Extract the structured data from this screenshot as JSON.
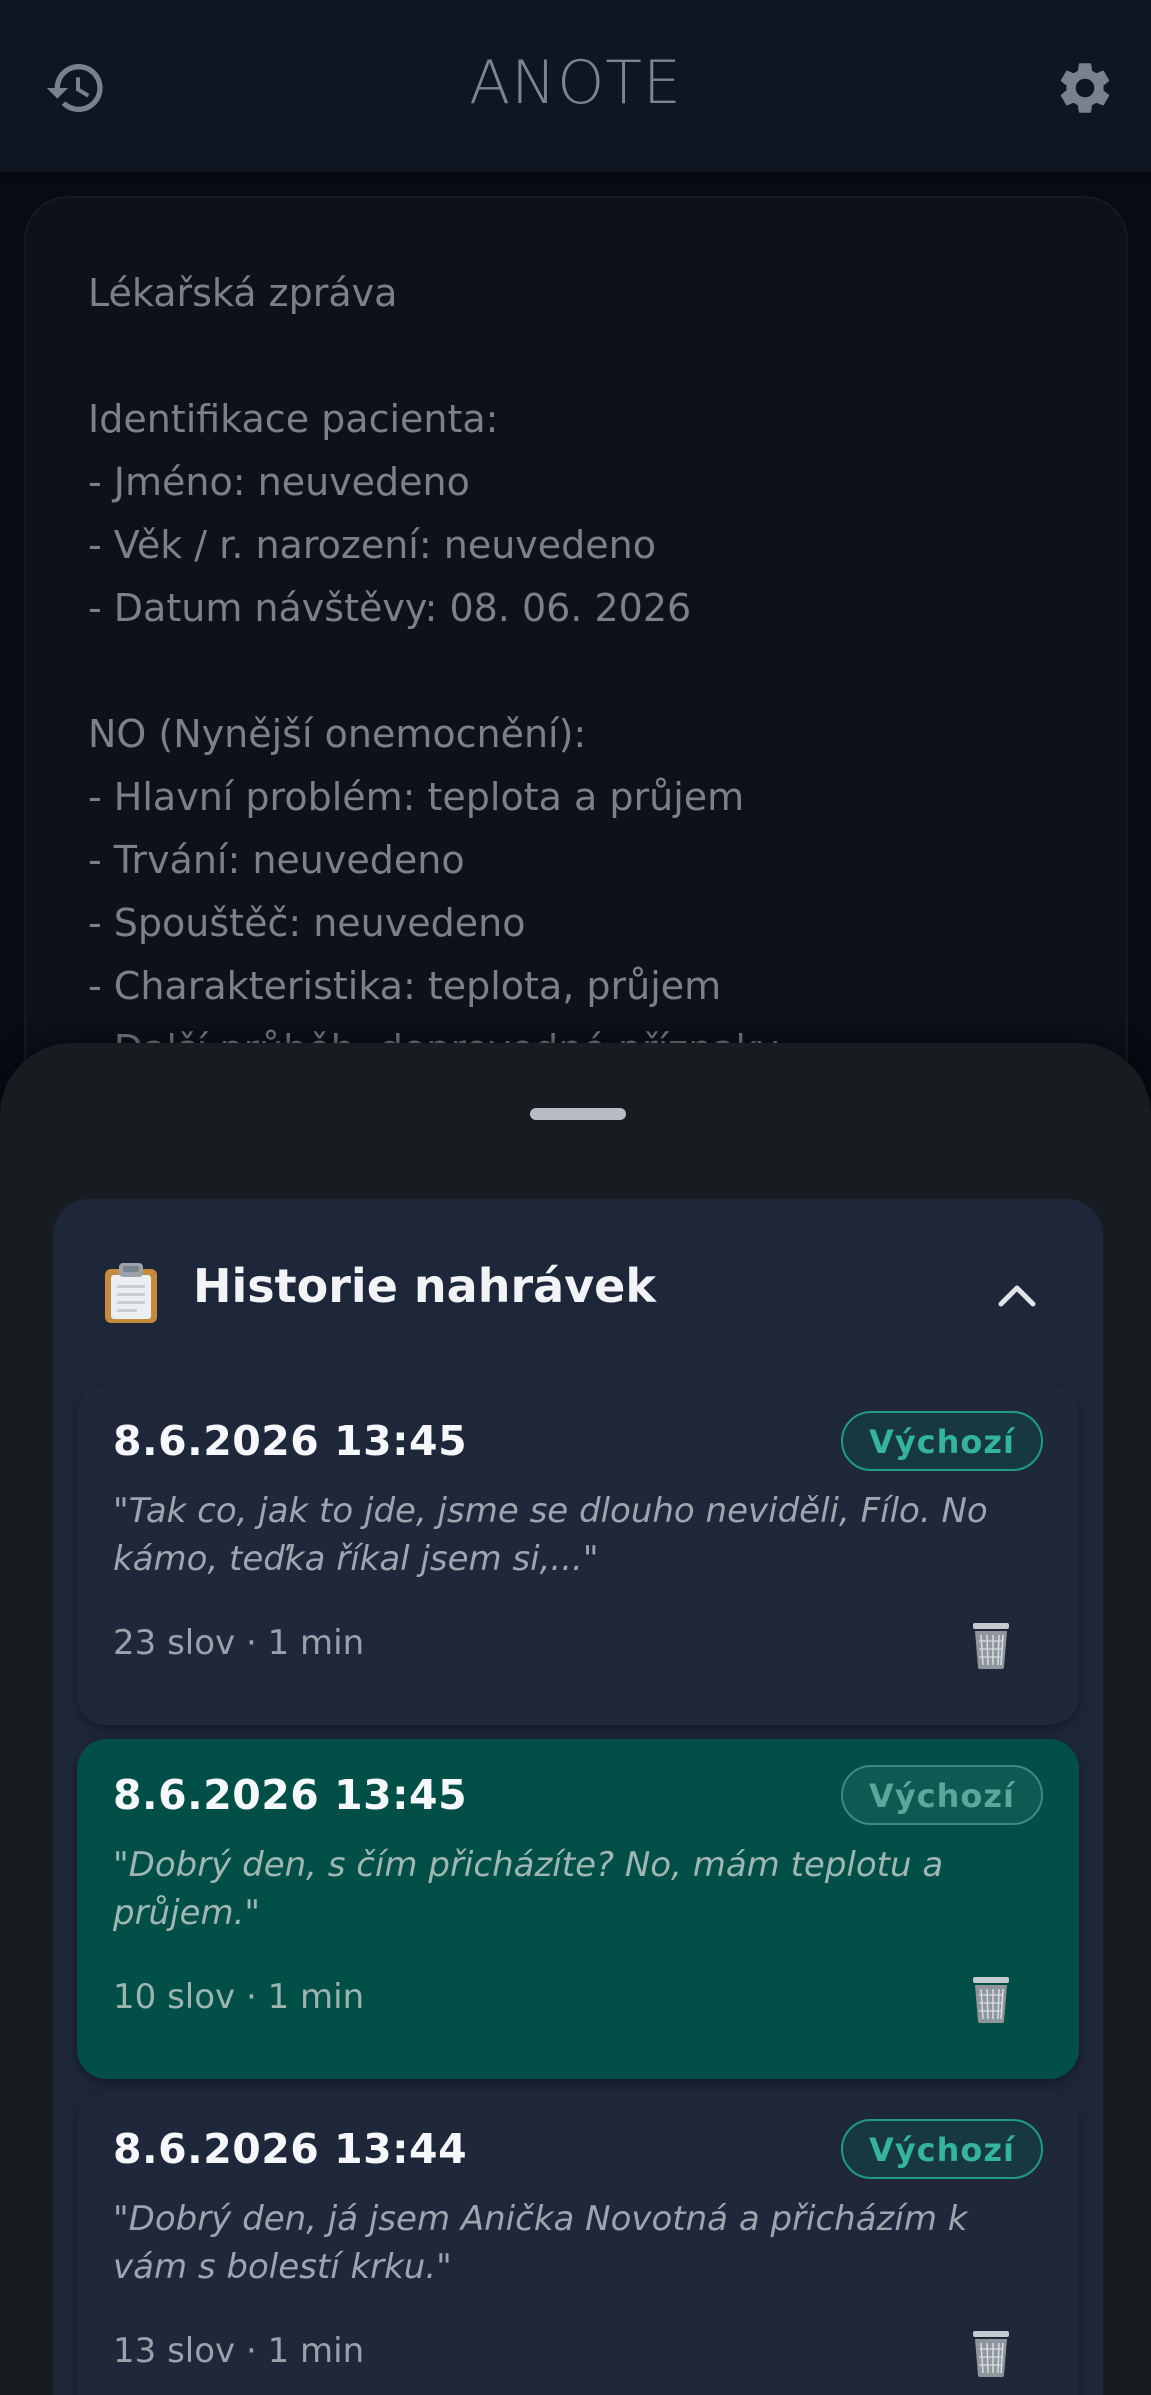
{
  "app": {
    "title": "ANOTE",
    "icons": {
      "left": "history-icon",
      "right": "gear-icon"
    }
  },
  "report": {
    "lines": [
      "Lékařská zpráva",
      "",
      "Identifikace pacienta:",
      "- Jméno: neuvedeno",
      "- Věk / r. narození: neuvedeno",
      "- Datum návštěvy: 08. 06. 2026",
      "",
      "NO (Nynější onemocnění):",
      "- Hlavní problém: teplota a průjem",
      "- Trvání: neuvedeno",
      "- Spouštěč: neuvedeno",
      "- Charakteristika: teplota, průjem",
      "- Další průběh, doprovodné příznaky"
    ]
  },
  "history": {
    "title": "Historie nahrávek",
    "icon": "clipboard-icon",
    "collapse_icon": "chevron-up-icon",
    "recordings": [
      {
        "date": "8.6.2026 13:45",
        "badge": "Výchozí",
        "quote": "\"Tak co, jak to jde, jsme se dlouho neviděli, Fílo. No kámo, teďka říkal jsem si,...\"",
        "meta": "23 slov · 1 min",
        "active": false
      },
      {
        "date": "8.6.2026 13:45",
        "badge": "Výchozí",
        "quote": "\"Dobrý den, s čím přicházíte? No, mám teplotu a průjem.\"",
        "meta": "10 slov · 1 min",
        "active": true
      },
      {
        "date": "8.6.2026 13:44",
        "badge": "Výchozí",
        "quote": "\"Dobrý den, já jsem Anička Novotná a přicházím k vám s bolestí krku.\"",
        "meta": "13 slov · 1 min",
        "active": false
      }
    ]
  },
  "colors": {
    "accent": "#024f47",
    "badge": "#34b39f",
    "panel": "#1e2739"
  }
}
